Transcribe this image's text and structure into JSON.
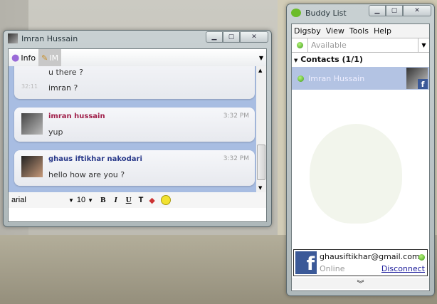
{
  "chat_window": {
    "title": "Imran Hussain",
    "tabs": [
      {
        "label": "Info",
        "icon": "lightbulb-icon"
      },
      {
        "label": "IM",
        "icon": "pencil-icon"
      }
    ],
    "messages": [
      {
        "text": "u there ?"
      },
      {
        "time": "32:11",
        "text": "imran ?"
      },
      {
        "sender": "imran hussain",
        "time": "3:32 PM",
        "text": "yup",
        "color": "#a0204a"
      },
      {
        "sender": "ghaus iftikhar nakodari",
        "time": "3:32 PM",
        "text": "hello how are you ?",
        "color": "#2a3a8a"
      }
    ],
    "format": {
      "font": "arial",
      "size": "10",
      "bold": "B",
      "italic": "I",
      "underline": "U"
    },
    "input_value": ""
  },
  "buddy_list": {
    "title": "Buddy List",
    "menu": [
      "Digsby",
      "View",
      "Tools",
      "Help"
    ],
    "status": "Available",
    "group": "Contacts (1/1)",
    "contacts": [
      {
        "name": "Imran Hussain",
        "status": "online"
      }
    ],
    "account": {
      "email": "ghausiftikhar@gmail.com",
      "state": "Online",
      "action": "Disconnect"
    }
  }
}
